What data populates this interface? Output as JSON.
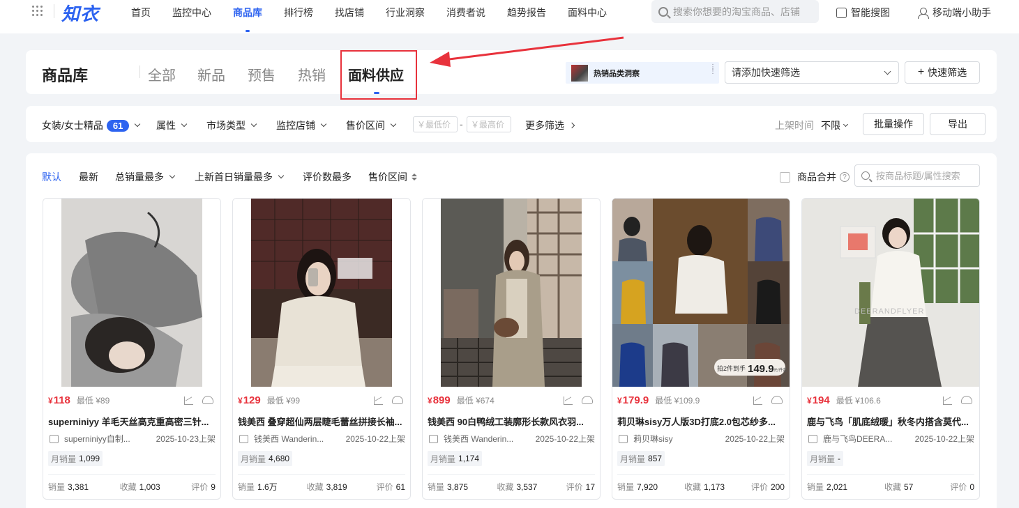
{
  "brand": {
    "logo_text": "知衣"
  },
  "topnav": {
    "items": [
      {
        "label": "首页",
        "active": false
      },
      {
        "label": "监控中心",
        "active": false
      },
      {
        "label": "商品库",
        "active": true
      },
      {
        "label": "排行榜",
        "active": false
      },
      {
        "label": "找店铺",
        "active": false
      },
      {
        "label": "行业洞察",
        "active": false
      },
      {
        "label": "消费者说",
        "active": false
      },
      {
        "label": "趋势报告",
        "active": false
      },
      {
        "label": "面料中心",
        "active": false
      }
    ],
    "search_placeholder": "搜索你想要的淘宝商品、店铺",
    "smart_search_label": "智能搜图",
    "mobile_helper_label": "移动端小助手"
  },
  "header": {
    "title": "商品库",
    "tabs": [
      {
        "label": "全部",
        "active": false
      },
      {
        "label": "新品",
        "active": false
      },
      {
        "label": "预售",
        "active": false
      },
      {
        "label": "热销",
        "active": false
      },
      {
        "label": "面料供应",
        "active": true
      }
    ],
    "insight_label": "热销品类洞察",
    "quick_filter_placeholder": "请添加快速筛选",
    "quick_filter_button": "快速筛选"
  },
  "filters": {
    "category_label": "女装/女士精品",
    "category_count": "61",
    "attribute_label": "属性",
    "market_type_label": "市场类型",
    "monitor_shop_label": "监控店铺",
    "price_range_label": "售价区间",
    "min_price_placeholder": "￥最低价",
    "max_price_placeholder": "￥最高价",
    "price_dash": "-",
    "more_filters_label": "更多筛选",
    "shelf_time_label": "上架时间",
    "shelf_time_value": "不限",
    "batch_button": "批量操作",
    "export_button": "导出"
  },
  "sort": {
    "items": [
      {
        "label": "默认",
        "active": true
      },
      {
        "label": "最新",
        "active": false
      },
      {
        "label": "总销量最多",
        "active": false
      },
      {
        "label": "上新首日销量最多",
        "active": false
      },
      {
        "label": "评价数最多",
        "active": false
      },
      {
        "label": "售价区间",
        "active": false
      }
    ],
    "merge_label": "商品合并",
    "merge_help": "?",
    "search_placeholder": "按商品标题/属性搜索"
  },
  "labels": {
    "lowest_prefix": "最低",
    "monthly_sales": "月销量",
    "sales": "销量",
    "favorites": "收藏",
    "reviews": "评价"
  },
  "products": [
    {
      "price": "118",
      "lowest": "¥89",
      "title": "superniniyy 羊毛天丝高克重高密三针...",
      "shop": "superniniyy自制...",
      "shelf_date": "2025-10-23上架",
      "monthly_sales": "1,099",
      "sales": "3,381",
      "favorites": "1,003",
      "reviews": "9"
    },
    {
      "price": "129",
      "lowest": "¥99",
      "title": "钱美西 叠穿超仙两层睫毛蕾丝拼接长袖...",
      "shop": "钱美西 Wanderin...",
      "shelf_date": "2025-10-22上架",
      "monthly_sales": "4,680",
      "sales": "1.6万",
      "favorites": "3,819",
      "reviews": "61"
    },
    {
      "price": "899",
      "lowest": "¥674",
      "title": "钱美西 90白鸭绒工装廓形长款风衣羽...",
      "shop": "钱美西 Wanderin...",
      "shelf_date": "2025-10-22上架",
      "monthly_sales": "1,174",
      "sales": "3,875",
      "favorites": "3,537",
      "reviews": "17"
    },
    {
      "price": "179.9",
      "lowest": "¥109.9",
      "title": "莉贝琳sisy万人版3D打底2.0包芯纱多...",
      "shop": "莉贝琳sisy",
      "shelf_date": "2025-10-22上架",
      "monthly_sales": "857",
      "sales": "7,920",
      "favorites": "1,173",
      "reviews": "200"
    },
    {
      "price": "194",
      "lowest": "¥106.6",
      "title": "鹿与飞鸟「肌底绒暖」秋冬内搭含莫代...",
      "shop": "鹿与飞鸟DEERA...",
      "shelf_date": "2025-10-22上架",
      "monthly_sales": "-",
      "sales": "2,021",
      "favorites": "57",
      "reviews": "0"
    }
  ],
  "image_text": {
    "p4_promo": "拍2件到手",
    "p4_promo_price": "149.9",
    "p4_promo_unit": "元/件起",
    "p5_brand": "DEERANDFLYER"
  },
  "colors": {
    "accent": "#2d63f0",
    "price": "#e8323c",
    "highlight": "#e8323c"
  }
}
